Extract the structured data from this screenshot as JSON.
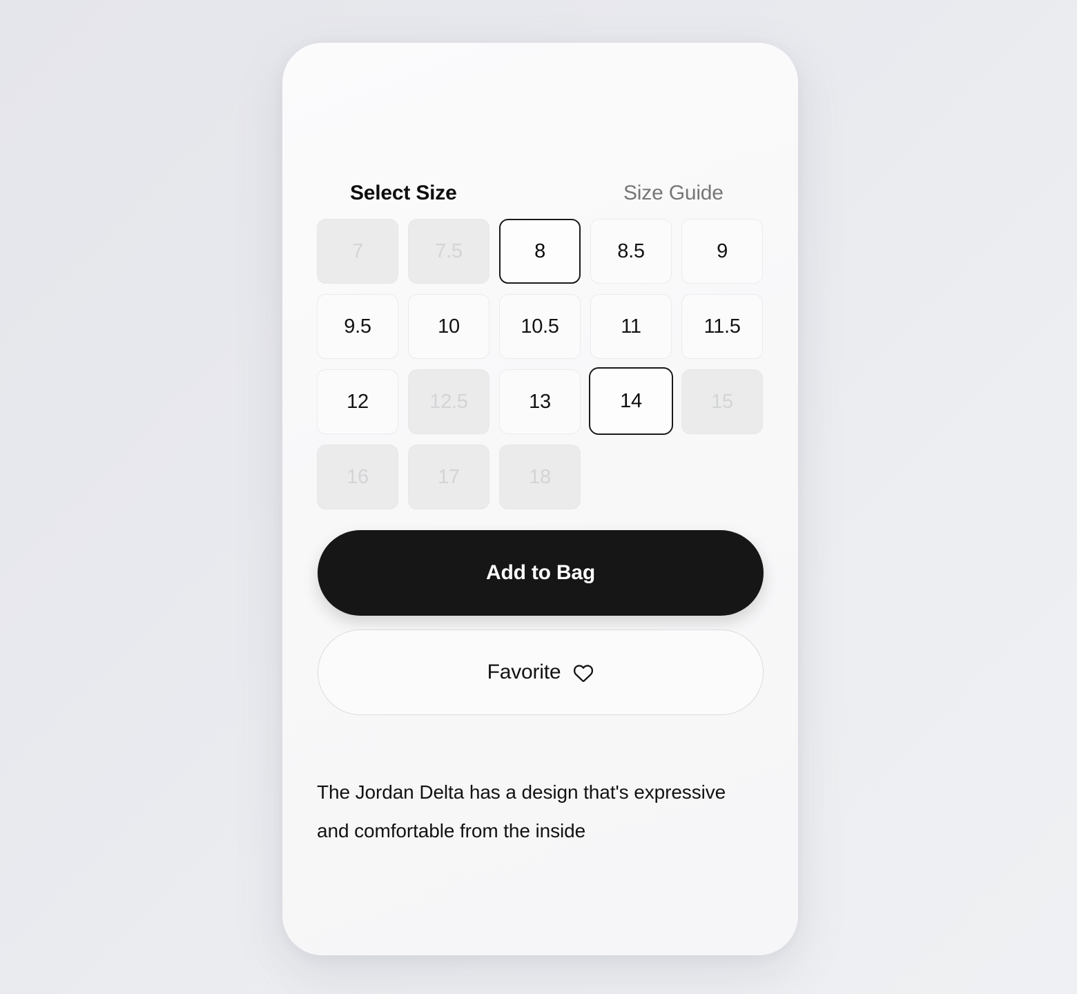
{
  "screen": {
    "background_color": "#e8e9ee",
    "card_background": "#fafafb"
  },
  "size_section": {
    "title": "Select Size",
    "size_guide_label": "Size Guide",
    "selected_size": "8",
    "focused_size": "14",
    "tiles": [
      {
        "label": "7",
        "state": "disabled"
      },
      {
        "label": "7.5",
        "state": "disabled"
      },
      {
        "label": "8",
        "state": "selected"
      },
      {
        "label": "8.5",
        "state": "available"
      },
      {
        "label": "9",
        "state": "available"
      },
      {
        "label": "9.5",
        "state": "available"
      },
      {
        "label": "10",
        "state": "available"
      },
      {
        "label": "10.5",
        "state": "available"
      },
      {
        "label": "11",
        "state": "available"
      },
      {
        "label": "11.5",
        "state": "available"
      },
      {
        "label": "12",
        "state": "available"
      },
      {
        "label": "12.5",
        "state": "disabled"
      },
      {
        "label": "13",
        "state": "available"
      },
      {
        "label": "14",
        "state": "focused"
      },
      {
        "label": "15",
        "state": "disabled"
      },
      {
        "label": "16",
        "state": "disabled"
      },
      {
        "label": "17",
        "state": "disabled"
      },
      {
        "label": "18",
        "state": "disabled"
      }
    ]
  },
  "actions": {
    "add_to_bag_label": "Add to Bag",
    "add_to_bag_color": "#161616",
    "favorite_label": "Favorite",
    "favorite_icon": "heart-outline-icon"
  },
  "product": {
    "description": "The Jordan Delta has a design that's expressive and comfortable from the inside"
  }
}
